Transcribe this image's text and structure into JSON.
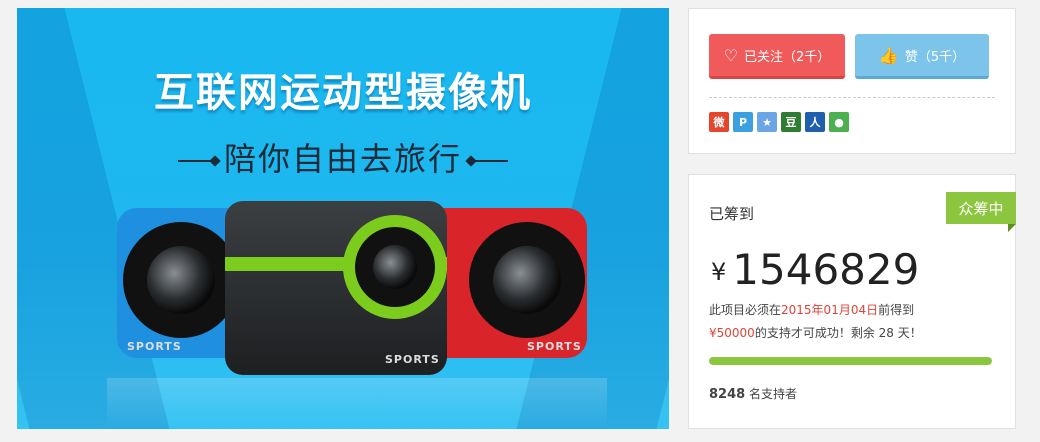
{
  "banner": {
    "title": "互联网运动型摄像机",
    "subtitle": "陪你自由去旅行",
    "cam_label_left": "SPORTS",
    "cam_label_center": "SPORTS",
    "cam_label_right": "SPORTS"
  },
  "actions": {
    "follow_label": "已关注（2千）",
    "like_label": "赞（5千）",
    "share_icons": [
      {
        "name": "weibo-icon",
        "glyph": "微",
        "color": "#e6452d"
      },
      {
        "name": "tencent-weibo-icon",
        "glyph": "P",
        "color": "#3aa0e0"
      },
      {
        "name": "qzone-icon",
        "glyph": "★",
        "color": "#6aa6e6"
      },
      {
        "name": "douban-icon",
        "glyph": "豆",
        "color": "#2e7d32"
      },
      {
        "name": "renren-icon",
        "glyph": "人",
        "color": "#1f5fae"
      },
      {
        "name": "wechat-icon",
        "glyph": "●",
        "color": "#4cb050"
      }
    ]
  },
  "funding": {
    "raised_label": "已筹到",
    "status": "众筹中",
    "currency": "¥",
    "amount": "1546829",
    "deadline_prefix": "此项目必须在",
    "deadline_date": "2015年01月04日",
    "deadline_suffix": "前得到",
    "goal": "¥50000",
    "goal_suffix": "的支持才可成功！剩余 28 天！",
    "progress_percent": 100,
    "supporters_count": "8248",
    "supporters_label": " 名支持者"
  }
}
